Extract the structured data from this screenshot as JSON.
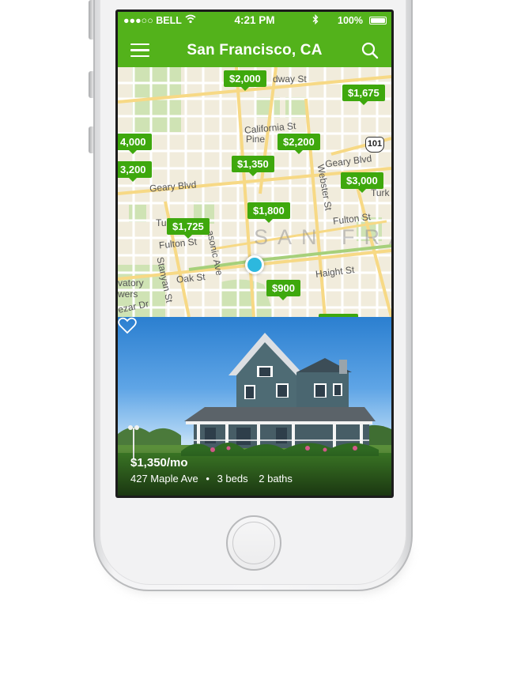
{
  "status_bar": {
    "carrier": "●●●○○ BELL",
    "time": "4:21 PM",
    "battery": "100%"
  },
  "header": {
    "title": "San Francisco, CA",
    "menu_icon": "hamburger-menu-icon",
    "search_icon": "search-icon"
  },
  "map": {
    "street_labels": [
      "dway St",
      "California St",
      "Pine",
      "Geary Blvd",
      "Geary Blvd",
      "Webster St",
      "Turk",
      "Tu",
      "Fulton St",
      "Fulton St",
      "asonic Ave",
      "Haight St",
      "Oak St",
      "Stanyan St",
      "vatory",
      "wers",
      "ezar Dr"
    ],
    "district_label": "SAN FRA",
    "highway_shield": "101",
    "price_pins": [
      "$2,000",
      "$1,675",
      "4,000",
      "$2,200",
      "$1,350",
      "3,200",
      "$3,000",
      "$1,800",
      "$1,725",
      "$900"
    ],
    "accent_color": "#53b21b"
  },
  "listing": {
    "price": "$1,350/mo",
    "address": "427 Maple Ave",
    "separator": "•",
    "beds": "3 beds",
    "baths": "2 baths",
    "favorite_icon": "heart-icon"
  }
}
